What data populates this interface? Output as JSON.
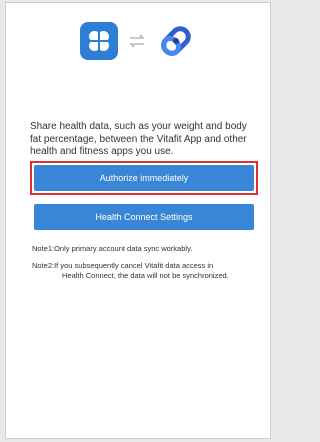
{
  "icons": {
    "app_logo": "clover-logo-icon",
    "sync": "sync-arrows-icon",
    "health_connect": "health-connect-icon"
  },
  "description": "Share health data, such as your weight and body fat percentage, between the Vitafit App and other health and fitness apps you use.",
  "buttons": {
    "authorize": "Authorize immediately",
    "settings": "Health Connect Settings"
  },
  "notes": {
    "note1": "Note1:Only primary account data sync workably.",
    "note2_line1": "Note2:If you subsequently cancel Vitafit data access in",
    "note2_line2": "Health Connect, the data will not be synchronized."
  },
  "colors": {
    "accent": "#3a86d6",
    "highlight": "#d9342b"
  }
}
